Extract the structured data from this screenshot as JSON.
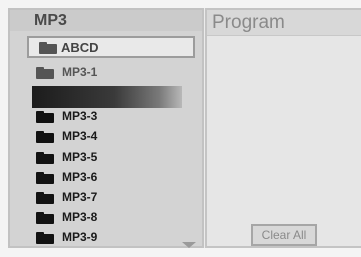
{
  "left_panel": {
    "title": "MP3",
    "current_folder": {
      "label": "ABCD",
      "icon": "folder-icon"
    },
    "items": [
      {
        "label": "MP3-1",
        "icon": "folder-icon",
        "style": "dim"
      },
      {
        "label": "",
        "icon": "",
        "style": "selected-highlight"
      },
      {
        "label": "MP3-3",
        "icon": "folder-icon",
        "style": "dark"
      },
      {
        "label": "MP3-4",
        "icon": "folder-icon",
        "style": "dark"
      },
      {
        "label": "MP3-5",
        "icon": "folder-icon",
        "style": "dark"
      },
      {
        "label": "MP3-6",
        "icon": "folder-icon",
        "style": "dark"
      },
      {
        "label": "MP3-7",
        "icon": "folder-icon",
        "style": "dark"
      },
      {
        "label": "MP3-8",
        "icon": "folder-icon",
        "style": "dark"
      },
      {
        "label": "MP3-9",
        "icon": "folder-icon",
        "style": "dark"
      }
    ],
    "scroll_indicator": "chevron-down-icon"
  },
  "right_panel": {
    "title": "Program",
    "clear_button": "Clear All"
  },
  "colors": {
    "panel_bg": "#d3d3d3",
    "program_bg": "#e6e6e6",
    "highlight_dark": "#1c1c1c",
    "text_dark": "#1a1a1a",
    "text_light": "#8a8a8a"
  }
}
